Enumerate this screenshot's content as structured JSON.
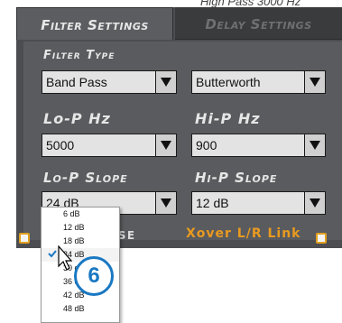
{
  "top_note": "High Pass 3000 Hz",
  "tabs": [
    {
      "label": "Filter Settings",
      "active": true
    },
    {
      "label": "Delay Settings",
      "active": false
    }
  ],
  "filter_type": {
    "label": "Filter Type",
    "type_value": "Band Pass",
    "shape_value": "Butterworth"
  },
  "lo_p": {
    "label": "Lo-P Hz",
    "value": "5000"
  },
  "hi_p": {
    "label": "Hi-P Hz",
    "value": "900"
  },
  "lo_slope": {
    "label": "Lo-P Slope",
    "value": "24 dB"
  },
  "hi_slope": {
    "label": "Hi-P Slope",
    "value": "12 dB"
  },
  "bottom": {
    "phase_label": "ASE",
    "xover_label": "Xover L/R Link"
  },
  "dropdown": {
    "options": [
      "6 dB",
      "12 dB",
      "18 dB",
      "24 dB",
      "30 dB",
      "36 dB",
      "42 dB",
      "48 dB"
    ],
    "selected": "24 dB"
  },
  "badge": {
    "number": "6"
  },
  "colors": {
    "accent_orange": "#e89a20",
    "badge_blue": "#1a78c2",
    "panel_bg": "#4c4d50"
  }
}
